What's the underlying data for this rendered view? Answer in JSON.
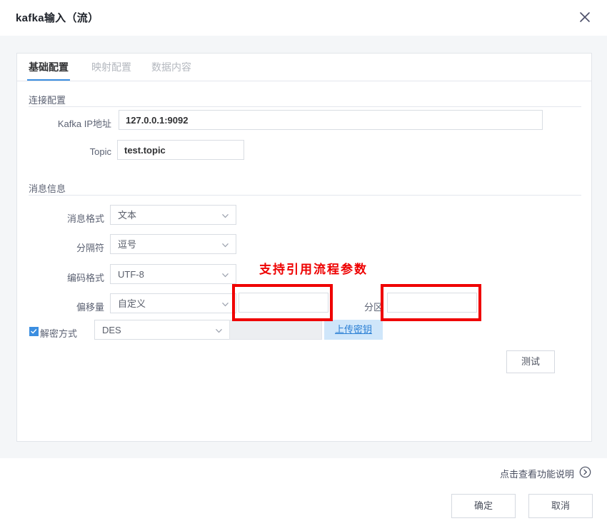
{
  "dialog": {
    "title": "kafka输入（流）",
    "close_icon": "close-icon"
  },
  "tabs": [
    {
      "label": "基础配置",
      "active": true
    },
    {
      "label": "映射配置",
      "active": false
    },
    {
      "label": "数据内容",
      "active": false
    }
  ],
  "sections": {
    "connection": {
      "heading": "连接配置",
      "fields": {
        "kafka_ip": {
          "label": "Kafka IP地址",
          "value": "127.0.0.1:9092",
          "placeholder": ""
        },
        "topic": {
          "label": "Topic",
          "value": "test.topic",
          "placeholder": ""
        }
      }
    },
    "message": {
      "heading": "消息信息",
      "fields": {
        "format": {
          "label": "消息格式",
          "value": "文本"
        },
        "delimiter": {
          "label": "分隔符",
          "value": "逗号"
        },
        "encoding": {
          "label": "编码格式",
          "value": "UTF-8"
        },
        "offset": {
          "label": "偏移量",
          "value": "自定义",
          "custom_value": "",
          "custom_placeholder": ""
        },
        "partition": {
          "label": "分区",
          "value": "",
          "placeholder": ""
        },
        "decrypt": {
          "label": "解密方式",
          "checked": true,
          "value": "DES",
          "key_value": "",
          "upload_label": "上传密钥"
        }
      }
    }
  },
  "annotation": {
    "text": "支持引用流程参数",
    "color": "#ee0000"
  },
  "actions": {
    "test_label": "测试",
    "help_label": "点击查看功能说明",
    "help_icon": "circle-arrow-right-icon",
    "confirm_label": "确定",
    "cancel_label": "取消"
  },
  "colors": {
    "accent": "#3b8ee0",
    "annotation": "#ee0000",
    "upload_bg": "#cfe6fa",
    "content_bg": "#f4f6f8"
  }
}
